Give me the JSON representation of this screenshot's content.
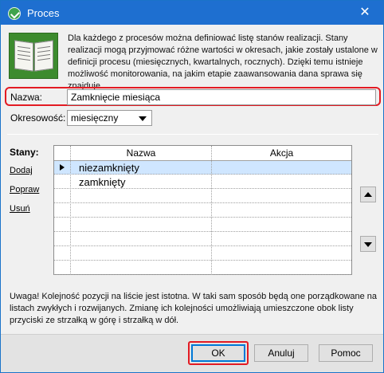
{
  "window": {
    "title": "Proces",
    "close_glyph": "✕"
  },
  "intro_text": "Dla każdego z procesów można definiować listę stanów realizacji. Stany realizacji mogą przyjmować różne wartości w okresach, jakie zostały ustalone w definicji procesu (miesięcznych, kwartalnych, rocznych). Dzięki temu istnieje możliwość monitorowania, na jakim etapie zaawansowania dana sprawa się znajduje.",
  "fields": {
    "name_label": "Nazwa:",
    "name_value": "Zamknięcie miesiąca",
    "period_label": "Okresowość:",
    "period_value": "miesięczny"
  },
  "states": {
    "label": "Stany:",
    "actions": [
      "Dodaj",
      "Popraw",
      "Usuń"
    ],
    "columns": [
      "Nazwa",
      "Akcja"
    ],
    "rows": [
      {
        "name": "niezamknięty",
        "action": "",
        "selected": true
      },
      {
        "name": "zamknięty",
        "action": "",
        "selected": false
      },
      {
        "name": "",
        "action": "",
        "selected": false
      },
      {
        "name": "",
        "action": "",
        "selected": false
      },
      {
        "name": "",
        "action": "",
        "selected": false
      },
      {
        "name": "",
        "action": "",
        "selected": false
      },
      {
        "name": "",
        "action": "",
        "selected": false
      },
      {
        "name": "",
        "action": "",
        "selected": false
      }
    ]
  },
  "note_text": "Uwaga! Kolejność pozycji na liście jest istotna. W taki sam sposób będą one porządkowane na listach zwykłych i rozwijanych. Zmianę ich kolejności umożliwiają umieszczone obok listy przyciski ze strzałką w górę i strzałką w dół.",
  "buttons": {
    "ok": "OK",
    "cancel": "Anuluj",
    "help": "Pomoc"
  },
  "colors": {
    "titlebar": "#1e6fd0",
    "highlight": "#e31b23",
    "selected_row": "#cfe6ff"
  }
}
